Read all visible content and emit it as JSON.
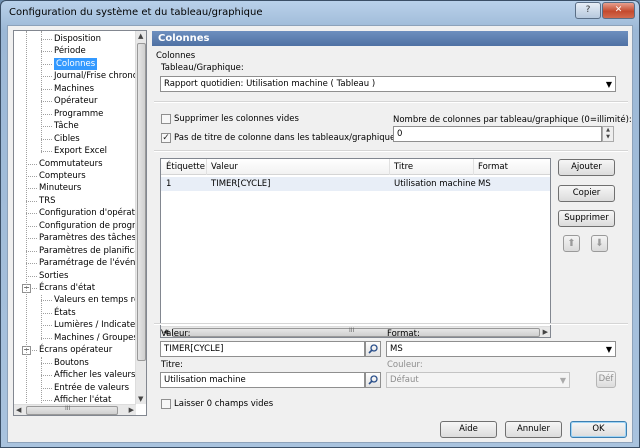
{
  "window": {
    "title": "Configuration du système et du tableau/graphique",
    "help_btn": "?",
    "close_btn": "✕"
  },
  "tree": {
    "items": [
      {
        "label": "Disposition"
      },
      {
        "label": "Période"
      },
      {
        "label": "Colonnes",
        "selected": true
      },
      {
        "label": "Journal/Frise chronolo"
      },
      {
        "label": "Machines"
      },
      {
        "label": "Opérateur"
      },
      {
        "label": "Programme"
      },
      {
        "label": "Tâche"
      },
      {
        "label": "Cibles"
      },
      {
        "label": "Export Excel"
      },
      {
        "label": "Commutateurs"
      },
      {
        "label": "Compteurs"
      },
      {
        "label": "Minuteurs"
      },
      {
        "label": "TRS"
      },
      {
        "label": "Configuration d'opérateur"
      },
      {
        "label": "Configuration de programm"
      },
      {
        "label": "Paramètres des tâches"
      },
      {
        "label": "Paramètres de planificatio"
      },
      {
        "label": "Paramétrage de l'événeme"
      },
      {
        "label": "Sorties"
      },
      {
        "label": "Écrans d'état"
      },
      {
        "label": "Valeurs en temps réel"
      },
      {
        "label": "États"
      },
      {
        "label": "Lumières / Indicateurs"
      },
      {
        "label": "Machines / Groupes"
      },
      {
        "label": "Écrans opérateur"
      },
      {
        "label": "Boutons"
      },
      {
        "label": "Afficher les valeurs"
      },
      {
        "label": "Entrée de valeurs"
      },
      {
        "label": "Afficher l'état"
      }
    ],
    "expand_minus": "−",
    "scroll_thumb_glyph": "III"
  },
  "panel": {
    "header": "Colonnes",
    "group_label": "Colonnes",
    "tableau_label": "Tableau/Graphique:",
    "tableau_value": "Rapport quotidien: Utilisation machine  ( Tableau )",
    "suppress_empty_label": "Supprimer les colonnes vides",
    "suppress_empty_checked": false,
    "no_title_label": "Pas de titre de colonne dans les tableaux/graphiques",
    "no_title_checked": true,
    "num_cols_label": "Nombre de colonnes par tableau/graphique (0=illimité):",
    "num_cols_value": "0"
  },
  "grid": {
    "headers": [
      "Étiquette",
      "Valeur",
      "Titre",
      "Format"
    ],
    "rows": [
      {
        "etiquette": "1",
        "valeur": "TIMER[CYCLE]",
        "titre": "Utilisation machine",
        "format": "MS"
      }
    ]
  },
  "side_buttons": {
    "ajouter": "Ajouter",
    "copier": "Copier",
    "supprimer": "Supprimer",
    "up": "⬆",
    "down": "⬇"
  },
  "editor": {
    "valeur_label": "Valeur:",
    "valeur_value": "TIMER[CYCLE]",
    "titre_label": "Titre:",
    "titre_value": "Utilisation machine",
    "format_label": "Format:",
    "format_value": "MS",
    "couleur_label": "Couleur:",
    "couleur_value": "Défaut",
    "def_btn": "Déf",
    "zero_fields_label": "Laisser 0 champs vides",
    "zero_fields_checked": false
  },
  "footer": {
    "aide": "Aide",
    "annuler": "Annuler",
    "ok": "OK"
  },
  "colors": {
    "header_bg": "#5577aa",
    "selection": "#3399ff",
    "close_red": "#c44a2e"
  }
}
